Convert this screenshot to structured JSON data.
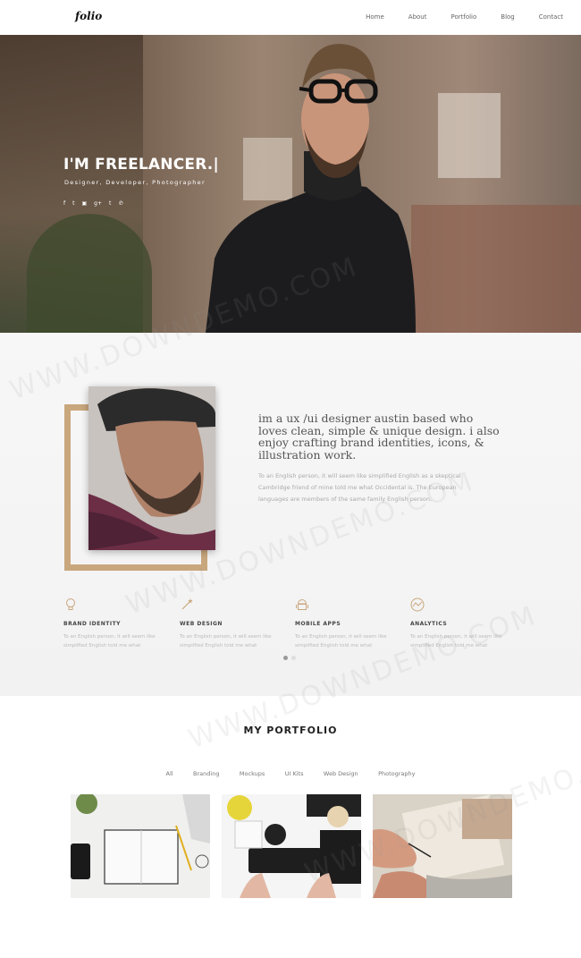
{
  "nav": {
    "logo": "folio",
    "links": [
      "Home",
      "About",
      "Portfolio",
      "Blog",
      "Contact"
    ]
  },
  "hero": {
    "title": "I'M FREELANCER.|",
    "subtitle": "Designer, Developer, Photographer",
    "social_icons": [
      "facebook-icon",
      "twitter-icon",
      "youtube-icon",
      "googleplus-icon",
      "tumblr-icon",
      "pinterest-icon"
    ],
    "social_glyphs": [
      "f",
      "t",
      "▣",
      "g+",
      "t",
      "℗"
    ]
  },
  "about": {
    "heading": "im a ux /ui designer austin based who loves clean, simple & unique design. i also enjoy crafting brand identities, icons, & illustration work.",
    "text": "To an English person, it will seem like simplified English as a skeptical Cambridge friend of mine told me what Occidental is. The European languages are members of the same family English person.",
    "frame_color": "#c9a77d"
  },
  "services": [
    {
      "icon": "lightbulb-icon",
      "title": "BRAND IDENTITY",
      "text": "To an English person, it will seem like simplified English told me what"
    },
    {
      "icon": "magic-wand-icon",
      "title": "WEB DESIGN",
      "text": "To an English person, it will seem like simplified English told me what"
    },
    {
      "icon": "android-icon",
      "title": "MOBILE APPS",
      "text": "To an English person, it will seem like simplified English told me what"
    },
    {
      "icon": "analytics-icon",
      "title": "ANALYTICS",
      "text": "To an English person, it will seem like simplified English told me what"
    }
  ],
  "portfolio": {
    "title": "MY PORTFOLIO",
    "filters": [
      "All",
      "Branding",
      "Mockups",
      "UI Kits",
      "Web Design",
      "Photography"
    ]
  },
  "watermark": "WWW.DOWNDEMO.COM",
  "accent": "#c9a77d"
}
